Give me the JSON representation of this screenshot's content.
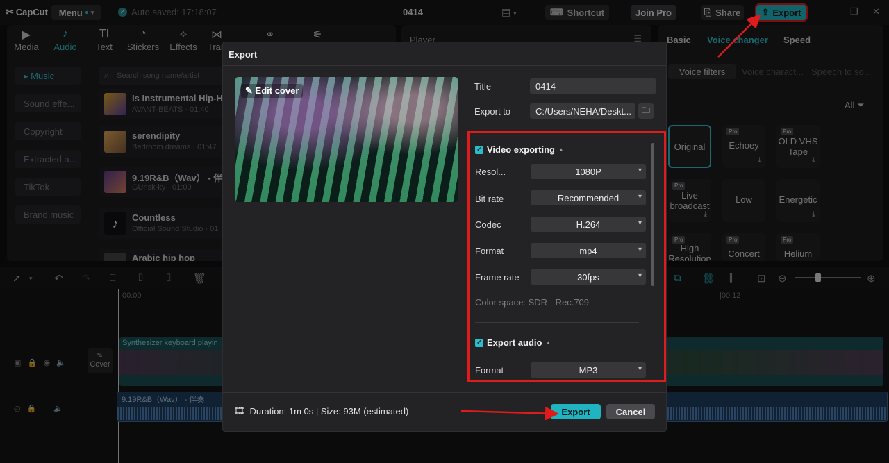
{
  "topbar": {
    "app_name": "CapCut",
    "menu_label": "Menu",
    "autosave": "Auto saved: 17:18:07",
    "project_title": "0414",
    "shortcut_label": "Shortcut",
    "join_pro_label": "Join Pro",
    "share_label": "Share",
    "export_label": "Export"
  },
  "toolbar": {
    "tabs": [
      {
        "label": "Media",
        "icon": "media-icon"
      },
      {
        "label": "Audio",
        "icon": "audio-icon"
      },
      {
        "label": "Text",
        "icon": "text-icon"
      },
      {
        "label": "Stickers",
        "icon": "stickers-icon"
      },
      {
        "label": "Effects",
        "icon": "effects-icon"
      },
      {
        "label": "Tran",
        "icon": "transitions-icon"
      }
    ]
  },
  "audio_categories": [
    "Music",
    "Sound effe...",
    "Copyright",
    "Extracted a...",
    "TikTok",
    "Brand music"
  ],
  "search": {
    "placeholder": "Search song name/artist"
  },
  "songs": [
    {
      "name": "Is Instrumental Hip-H",
      "sub": "AVANT-BEATS · 01:40"
    },
    {
      "name": "serendipity",
      "sub": "Bedroom dreams · 01:47"
    },
    {
      "name": "9.19R&B（Wav） - 伴",
      "sub": "GUnsk-ky · 01:00"
    },
    {
      "name": "Countless",
      "sub": "Official Sound Studio · 01"
    },
    {
      "name": "Arabic hip hop",
      "sub": ""
    }
  ],
  "player": {
    "title": "Player"
  },
  "right_panel": {
    "tabs": [
      "Basic",
      "Voice changer",
      "Speed"
    ],
    "subtabs": [
      "Voice filters",
      "Voice charact...",
      "Speech to so..."
    ],
    "filter_label": "All",
    "voices": [
      {
        "label": "Original",
        "pro": ""
      },
      {
        "label": "Echoey",
        "pro": "Pro"
      },
      {
        "label": "OLD VHS Tape",
        "pro": "Pro"
      },
      {
        "label": "Live broadcast",
        "pro": "Pro"
      },
      {
        "label": "Low",
        "pro": ""
      },
      {
        "label": "Energetic",
        "pro": ""
      },
      {
        "label": "High Resolution",
        "pro": "Pro"
      },
      {
        "label": "Concert",
        "pro": "Pro"
      },
      {
        "label": "Helium",
        "pro": "Pro"
      }
    ]
  },
  "timeline": {
    "time_start": "00:00",
    "time_mark": "|00:12",
    "video_clip_label": "Synthesizer keyboard playin",
    "cover_label": "Cover",
    "audio_clip_label": "9.19R&B（Wav） - 伴奏"
  },
  "export_dialog": {
    "title": "Export",
    "edit_cover": "Edit cover",
    "title_label": "Title",
    "title_value": "0414",
    "export_to_label": "Export to",
    "export_to_value": "C:/Users/NEHA/Deskt...",
    "video_section": "Video exporting",
    "resolution_label": "Resol...",
    "resolution_value": "1080P",
    "bitrate_label": "Bit rate",
    "bitrate_value": "Recommended",
    "codec_label": "Codec",
    "codec_value": "H.264",
    "format_label": "Format",
    "format_value": "mp4",
    "framerate_label": "Frame rate",
    "framerate_value": "30fps",
    "colorspace": "Color space: SDR - Rec.709",
    "audio_section": "Export audio",
    "audio_format_label": "Format",
    "audio_format_value": "MP3",
    "duration": "Duration: 1m 0s | Size: 93M (estimated)",
    "export_button": "Export",
    "cancel_button": "Cancel"
  },
  "colors": {
    "accent": "#1fb4c0",
    "highlight": "#e01b1b"
  }
}
